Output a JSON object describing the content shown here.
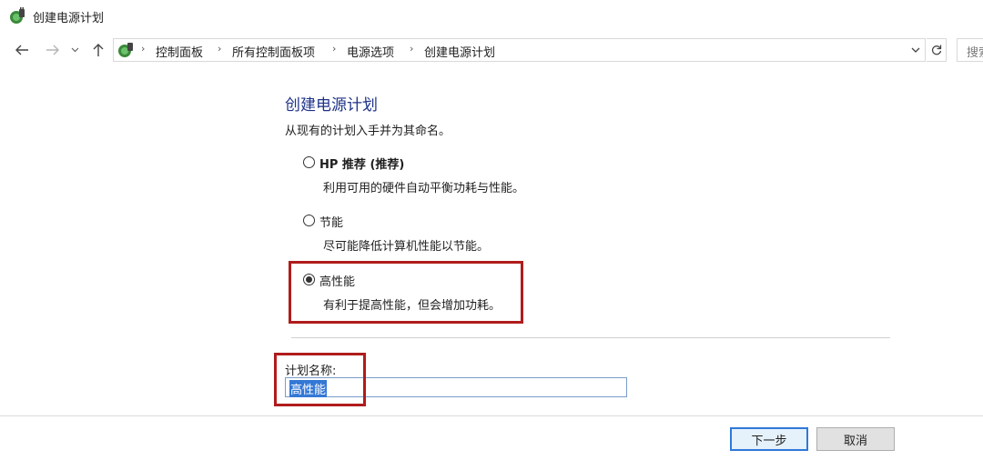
{
  "window": {
    "title": "创建电源计划"
  },
  "nav": {
    "breadcrumb": [
      "控制面板",
      "所有控制面板项",
      "电源选项",
      "创建电源计划"
    ],
    "search_placeholder": "搜索"
  },
  "content": {
    "title": "创建电源计划",
    "subtitle": "从现有的计划入手并为其命名。",
    "options": [
      {
        "label": "HP 推荐 (推荐)",
        "description": "利用可用的硬件自动平衡功耗与性能。",
        "selected": false
      },
      {
        "label": "节能",
        "description": "尽可能降低计算机性能以节能。",
        "selected": false
      },
      {
        "label": "高性能",
        "description": "有利于提高性能，但会增加功耗。",
        "selected": true
      }
    ],
    "plan_name_label": "计划名称:",
    "plan_name_value": "高性能"
  },
  "buttons": {
    "next": "下一步",
    "cancel": "取消"
  },
  "colors": {
    "highlight_box": "#b01c1c",
    "title_blue": "#1e3287",
    "selection": "#3478d6"
  }
}
